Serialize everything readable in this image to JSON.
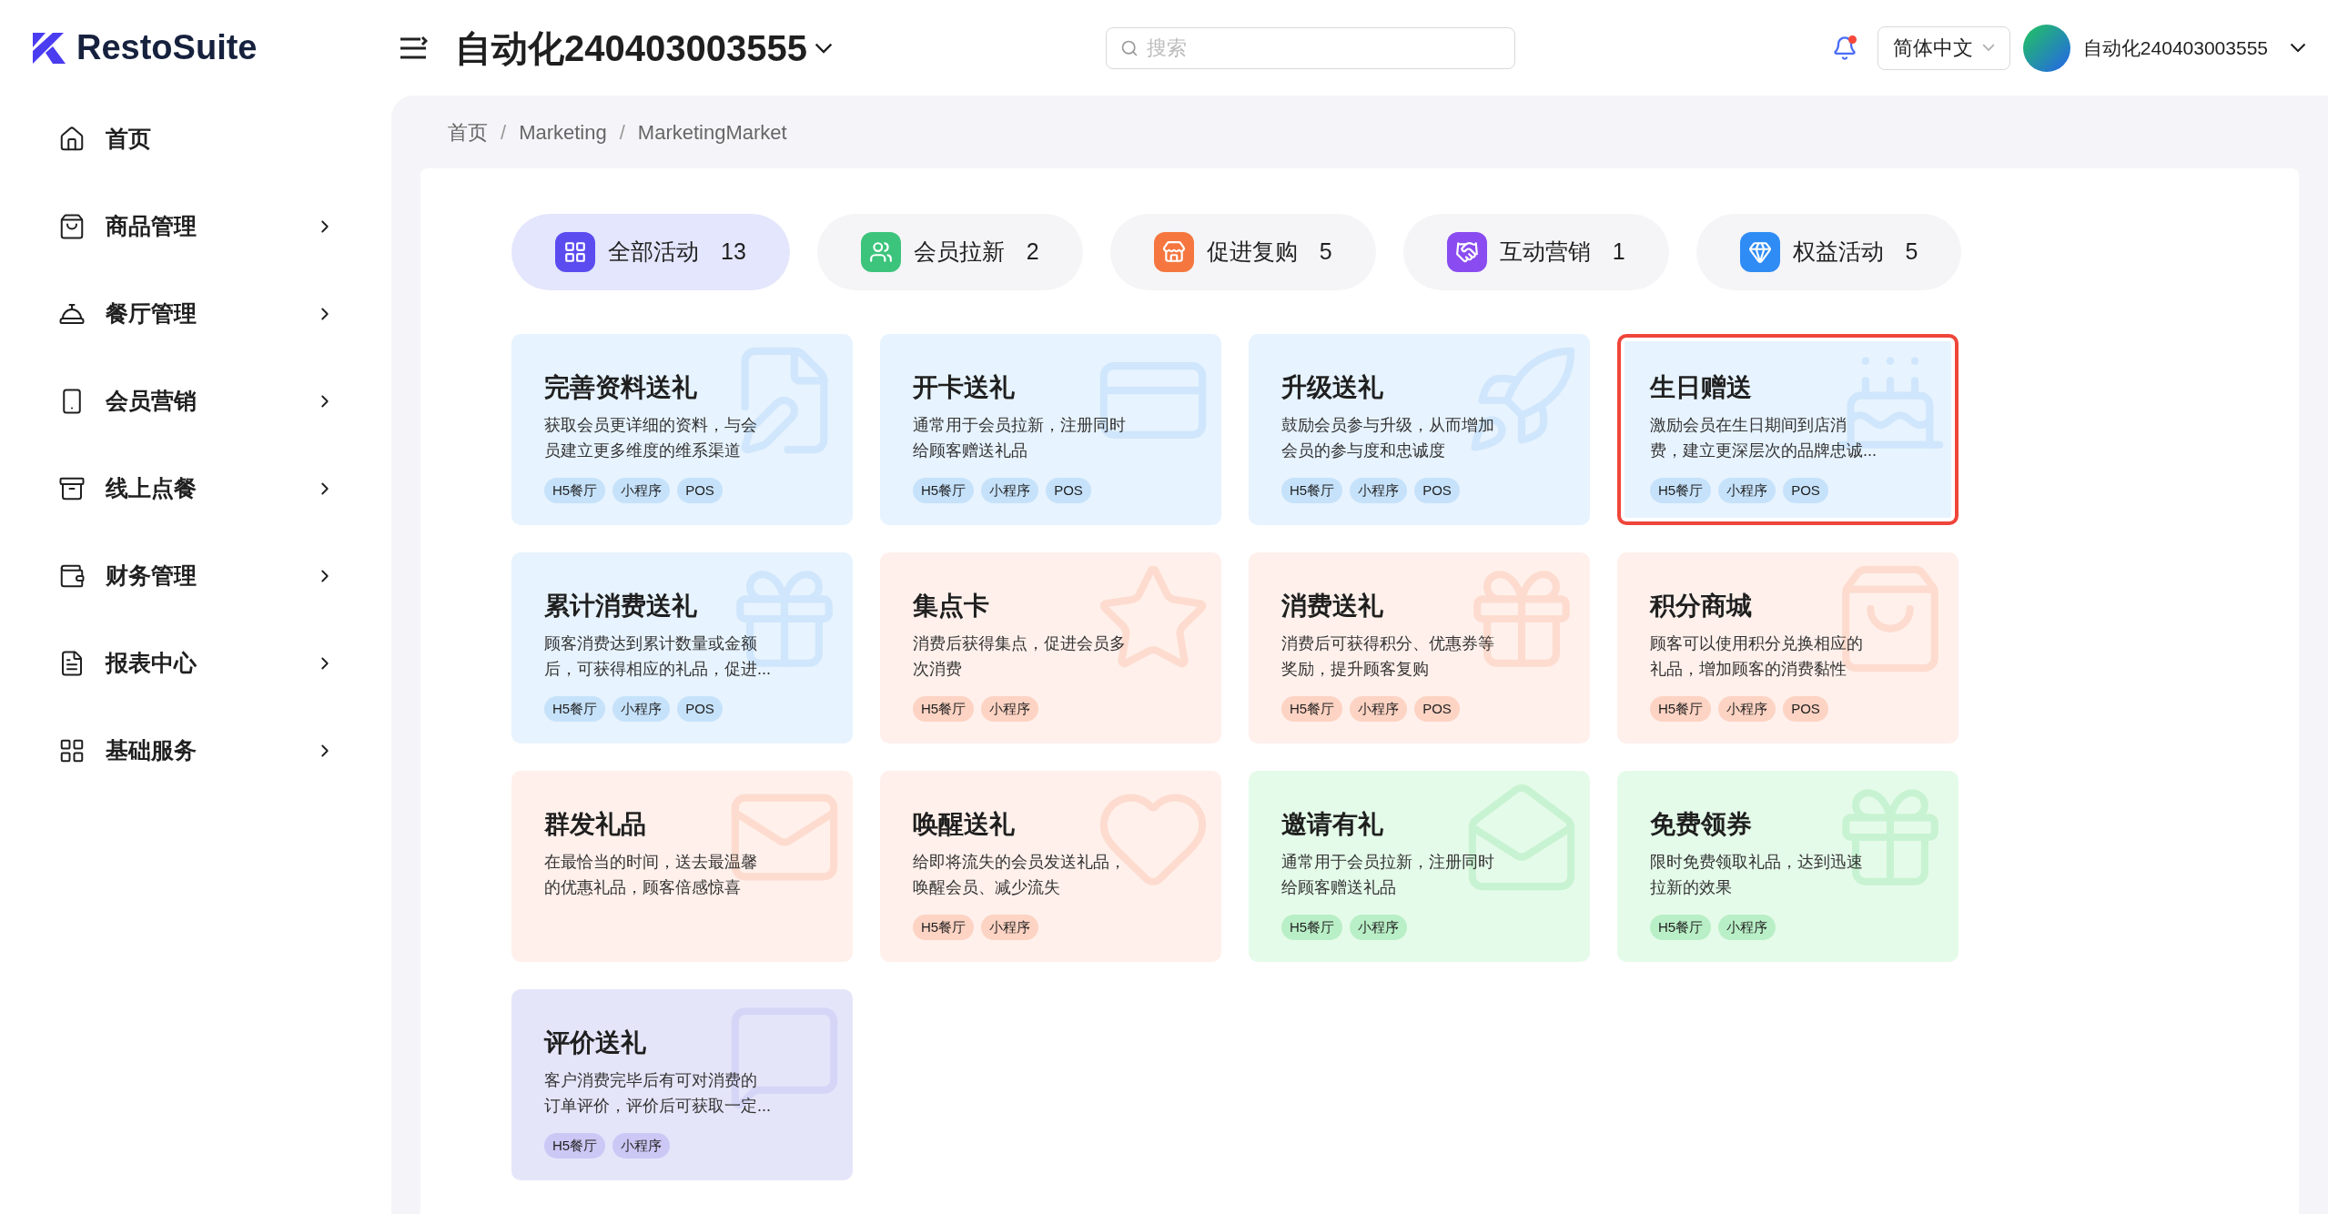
{
  "header": {
    "logo": "RestoSuite",
    "title": "自动化240403003555",
    "search": {
      "placeholder": "搜索"
    },
    "notification_dot": true,
    "language": "简体中文",
    "user": "自动化240403003555"
  },
  "sidebar": {
    "items": [
      {
        "label": "首页",
        "expandable": false
      },
      {
        "label": "商品管理",
        "expandable": true
      },
      {
        "label": "餐厅管理",
        "expandable": true
      },
      {
        "label": "会员营销",
        "expandable": true
      },
      {
        "label": "线上点餐",
        "expandable": true
      },
      {
        "label": "财务管理",
        "expandable": true
      },
      {
        "label": "报表中心",
        "expandable": true
      },
      {
        "label": "基础服务",
        "expandable": true
      }
    ]
  },
  "breadcrumb": {
    "separator": "/",
    "items": [
      "首页",
      "Marketing",
      "MarketingMarket"
    ]
  },
  "tabs": [
    {
      "label": "全部活动",
      "count": "13",
      "selected": true,
      "color": "#5b4cf0"
    },
    {
      "label": "会员拉新",
      "count": "2",
      "selected": false,
      "color": "#3cc47c"
    },
    {
      "label": "促进复购",
      "count": "5",
      "selected": false,
      "color": "#f5773f"
    },
    {
      "label": "互动营销",
      "count": "1",
      "selected": false,
      "color": "#8a4cf0"
    },
    {
      "label": "权益活动",
      "count": "5",
      "selected": false,
      "color": "#2f8cf5"
    }
  ],
  "cards": [
    {
      "title": "完善资料送礼",
      "description": "获取会员更详细的资料，与会员建立更多维度的维系渠道",
      "color": "#e7f3fe",
      "selected": false,
      "tags": [
        "H5餐厅",
        "小程序",
        "POS"
      ]
    },
    {
      "title": "开卡送礼",
      "description": "通常用于会员拉新，注册同时给顾客赠送礼品",
      "color": "#e7f3fe",
      "selected": false,
      "tags": [
        "H5餐厅",
        "小程序",
        "POS"
      ]
    },
    {
      "title": "升级送礼",
      "description": "鼓励会员参与升级，从而增加会员的参与度和忠诚度",
      "color": "#e7f3fe",
      "selected": false,
      "tags": [
        "H5餐厅",
        "小程序",
        "POS"
      ]
    },
    {
      "title": "生日赠送",
      "description": "激励会员在生日期间到店消费，建立更深层次的品牌忠诚...",
      "color": "#e7f3fe",
      "selected": true,
      "tags": [
        "H5餐厅",
        "小程序",
        "POS"
      ]
    },
    {
      "title": "累计消费送礼",
      "description": "顾客消费达到累计数量或金额后，可获得相应的礼品，促进...",
      "color": "#e7f3fe",
      "selected": false,
      "tags": [
        "H5餐厅",
        "小程序",
        "POS"
      ]
    },
    {
      "title": "集点卡",
      "description": "消费后获得集点，促进会员多次消费",
      "color": "#fff0eb",
      "selected": false,
      "tags": [
        "H5餐厅",
        "小程序"
      ]
    },
    {
      "title": "消费送礼",
      "description": "消费后可获得积分、优惠券等奖励，提升顾客复购",
      "color": "#fff0eb",
      "selected": false,
      "tags": [
        "H5餐厅",
        "小程序",
        "POS"
      ]
    },
    {
      "title": "积分商城",
      "description": "顾客可以使用积分兑换相应的礼品，增加顾客的消费黏性",
      "color": "#fff0eb",
      "selected": false,
      "tags": [
        "H5餐厅",
        "小程序",
        "POS"
      ]
    },
    {
      "title": "群发礼品",
      "description": "在最恰当的时间，送去最温馨的优惠礼品，顾客倍感惊喜",
      "color": "#fff0eb",
      "selected": false
    },
    {
      "title": "唤醒送礼",
      "description": "给即将流失的会员发送礼品，唤醒会员、减少流失",
      "color": "#fff0eb",
      "selected": false,
      "tags": [
        "H5餐厅",
        "小程序"
      ]
    },
    {
      "title": "邀请有礼",
      "description": "通常用于会员拉新，注册同时给顾客赠送礼品",
      "color": "#e5fbea",
      "selected": false,
      "tags": [
        "H5餐厅",
        "小程序"
      ]
    },
    {
      "title": "免费领券",
      "description": "限时免费领取礼品，达到迅速拉新的效果",
      "color": "#e5fbea",
      "selected": false,
      "tags": [
        "H5餐厅",
        "小程序"
      ]
    },
    {
      "title": "评价送礼",
      "description": "客户消费完毕后有可对消费的订单评价，评价后可获取一定...",
      "color": "#e5e5fa",
      "selected": false,
      "tags": [
        "H5餐厅",
        "小程序"
      ]
    }
  ]
}
